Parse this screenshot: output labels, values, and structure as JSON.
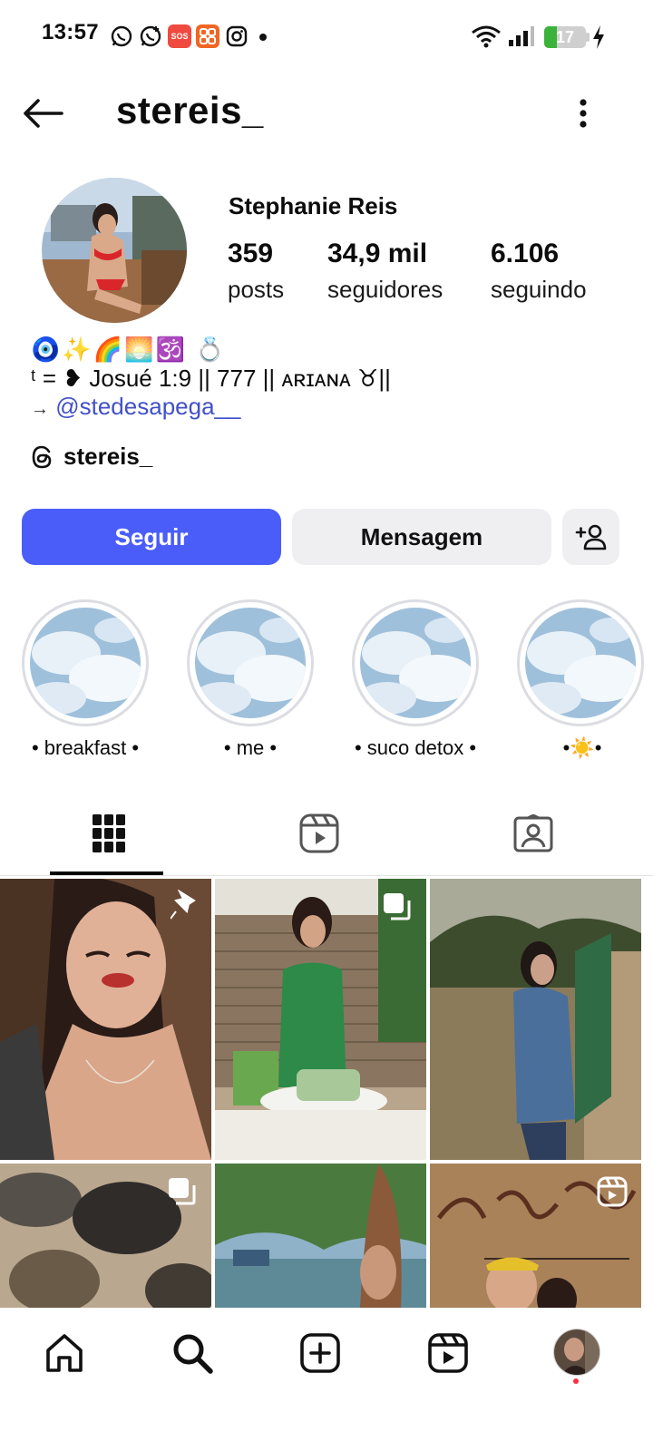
{
  "status_bar": {
    "time": "13:57",
    "battery": "17",
    "icons": [
      "whatsapp-icon",
      "whatsapp-business-icon",
      "sos-app-icon",
      "grid-app-icon",
      "instagram-icon",
      "wifi-icon",
      "signal-icon",
      "battery-icon",
      "charging-icon"
    ],
    "sos_label": "SOS"
  },
  "header": {
    "username": "stereis_"
  },
  "profile": {
    "full_name": "Stephanie Reis",
    "stats": [
      {
        "value": "359",
        "label": "posts"
      },
      {
        "value": "34,9 mil",
        "label": "seguidores"
      },
      {
        "value": "6.106",
        "label": "seguindo"
      }
    ],
    "bio_emojis": "🧿✨🌈🌅🕉️ 💍",
    "bio_line": "ᵗ = ❥ Josué 1:9 || 777 || ᴀʀɪᴀɴᴀ ♉||",
    "bio_link_prefix": "→",
    "bio_link": "@stedesapega__",
    "threads_name": "stereis_"
  },
  "actions": {
    "follow": "Seguir",
    "message": "Mensagem"
  },
  "highlights": [
    {
      "label": "• breakfast •"
    },
    {
      "label": "• me •"
    },
    {
      "label": "• suco detox •"
    },
    {
      "label": "•☀️•"
    }
  ],
  "tabs": [
    "grid-icon",
    "reels-icon",
    "tagged-icon"
  ],
  "colors": {
    "accent": "#4a5df9",
    "link": "#4150c9",
    "button_secondary": "#efeff2"
  }
}
